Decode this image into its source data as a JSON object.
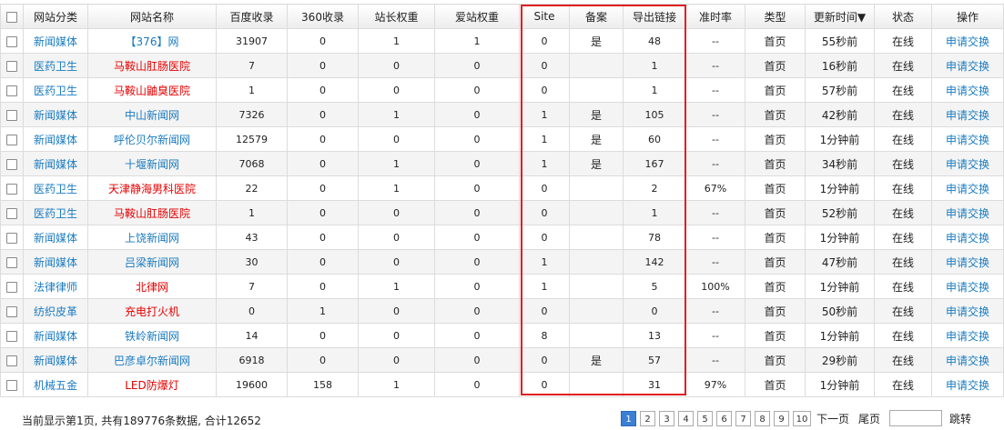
{
  "table": {
    "headers": [
      "网站分类",
      "网站名称",
      "百度收录",
      "360收录",
      "站长权重",
      "爱站权重",
      "Site",
      "备案",
      "导出链接",
      "准时率",
      "类型",
      "更新时间▼",
      "状态",
      "操作"
    ],
    "rows": [
      {
        "cat": "新闻媒体",
        "name": "【376】网",
        "name_color": "blue",
        "baidu": "31907",
        "s360": "0",
        "zz": "1",
        "az": "1",
        "site": "0",
        "beian": "是",
        "out": "48",
        "rate": "--",
        "type": "首页",
        "time": "55秒前",
        "status": "在线",
        "op": "申请交换"
      },
      {
        "cat": "医药卫生",
        "name": "马鞍山肛肠医院",
        "name_color": "red",
        "baidu": "7",
        "s360": "0",
        "zz": "0",
        "az": "0",
        "site": "0",
        "beian": "",
        "out": "1",
        "rate": "--",
        "type": "首页",
        "time": "16秒前",
        "status": "在线",
        "op": "申请交换"
      },
      {
        "cat": "医药卫生",
        "name": "马鞍山鼬臭医院",
        "name_color": "red",
        "baidu": "1",
        "s360": "0",
        "zz": "0",
        "az": "0",
        "site": "0",
        "beian": "",
        "out": "1",
        "rate": "--",
        "type": "首页",
        "time": "57秒前",
        "status": "在线",
        "op": "申请交换"
      },
      {
        "cat": "新闻媒体",
        "name": "中山新闻网",
        "name_color": "blue",
        "baidu": "7326",
        "s360": "0",
        "zz": "1",
        "az": "0",
        "site": "1",
        "beian": "是",
        "out": "105",
        "rate": "--",
        "type": "首页",
        "time": "42秒前",
        "status": "在线",
        "op": "申请交换"
      },
      {
        "cat": "新闻媒体",
        "name": "呼伦贝尔新闻网",
        "name_color": "blue",
        "baidu": "12579",
        "s360": "0",
        "zz": "0",
        "az": "0",
        "site": "1",
        "beian": "是",
        "out": "60",
        "rate": "--",
        "type": "首页",
        "time": "1分钟前",
        "status": "在线",
        "op": "申请交换"
      },
      {
        "cat": "新闻媒体",
        "name": "十堰新闻网",
        "name_color": "blue",
        "baidu": "7068",
        "s360": "0",
        "zz": "1",
        "az": "0",
        "site": "1",
        "beian": "是",
        "out": "167",
        "rate": "--",
        "type": "首页",
        "time": "34秒前",
        "status": "在线",
        "op": "申请交换"
      },
      {
        "cat": "医药卫生",
        "name": "天津静海男科医院",
        "name_color": "red",
        "baidu": "22",
        "s360": "0",
        "zz": "1",
        "az": "0",
        "site": "0",
        "beian": "",
        "out": "2",
        "rate": "67%",
        "type": "首页",
        "time": "1分钟前",
        "status": "在线",
        "op": "申请交换"
      },
      {
        "cat": "医药卫生",
        "name": "马鞍山肛肠医院",
        "name_color": "red",
        "baidu": "1",
        "s360": "0",
        "zz": "0",
        "az": "0",
        "site": "0",
        "beian": "",
        "out": "1",
        "rate": "--",
        "type": "首页",
        "time": "52秒前",
        "status": "在线",
        "op": "申请交换"
      },
      {
        "cat": "新闻媒体",
        "name": "上饶新闻网",
        "name_color": "blue",
        "baidu": "43",
        "s360": "0",
        "zz": "0",
        "az": "0",
        "site": "0",
        "beian": "",
        "out": "78",
        "rate": "--",
        "type": "首页",
        "time": "1分钟前",
        "status": "在线",
        "op": "申请交换"
      },
      {
        "cat": "新闻媒体",
        "name": "吕梁新闻网",
        "name_color": "blue",
        "baidu": "30",
        "s360": "0",
        "zz": "0",
        "az": "0",
        "site": "1",
        "beian": "",
        "out": "142",
        "rate": "--",
        "type": "首页",
        "time": "47秒前",
        "status": "在线",
        "op": "申请交换"
      },
      {
        "cat": "法律律师",
        "name": "北律网",
        "name_color": "red",
        "baidu": "7",
        "s360": "0",
        "zz": "1",
        "az": "0",
        "site": "1",
        "beian": "",
        "out": "5",
        "rate": "100%",
        "type": "首页",
        "time": "1分钟前",
        "status": "在线",
        "op": "申请交换"
      },
      {
        "cat": "纺织皮革",
        "name": "充电打火机",
        "name_color": "red",
        "baidu": "0",
        "s360": "1",
        "zz": "0",
        "az": "0",
        "site": "0",
        "beian": "",
        "out": "0",
        "rate": "--",
        "type": "首页",
        "time": "50秒前",
        "status": "在线",
        "op": "申请交换"
      },
      {
        "cat": "新闻媒体",
        "name": "铁岭新闻网",
        "name_color": "blue",
        "baidu": "14",
        "s360": "0",
        "zz": "0",
        "az": "0",
        "site": "8",
        "beian": "",
        "out": "13",
        "rate": "--",
        "type": "首页",
        "time": "1分钟前",
        "status": "在线",
        "op": "申请交换"
      },
      {
        "cat": "新闻媒体",
        "name": "巴彦卓尔新闻网",
        "name_color": "blue",
        "baidu": "6918",
        "s360": "0",
        "zz": "0",
        "az": "0",
        "site": "0",
        "beian": "是",
        "out": "57",
        "rate": "--",
        "type": "首页",
        "time": "29秒前",
        "status": "在线",
        "op": "申请交换"
      },
      {
        "cat": "机械五金",
        "name": "LED防爆灯",
        "name_color": "red",
        "baidu": "19600",
        "s360": "158",
        "zz": "1",
        "az": "0",
        "site": "0",
        "beian": "",
        "out": "31",
        "rate": "97%",
        "type": "首页",
        "time": "1分钟前",
        "status": "在线",
        "op": "申请交换"
      }
    ]
  },
  "footer": {
    "summary": "当前显示第1页, 共有189776条数据, 合计12652",
    "pages": [
      "1",
      "2",
      "3",
      "4",
      "5",
      "6",
      "7",
      "8",
      "9",
      "10"
    ],
    "current_page": "1",
    "next_label": "下一页",
    "last_label": "尾页",
    "jump_label": "跳转",
    "jump_value": ""
  },
  "colors": {
    "link_blue": "#1a7bc0",
    "link_red": "#e60000",
    "highlight": "#e02020",
    "current_page_bg": "#3a7fd4"
  }
}
